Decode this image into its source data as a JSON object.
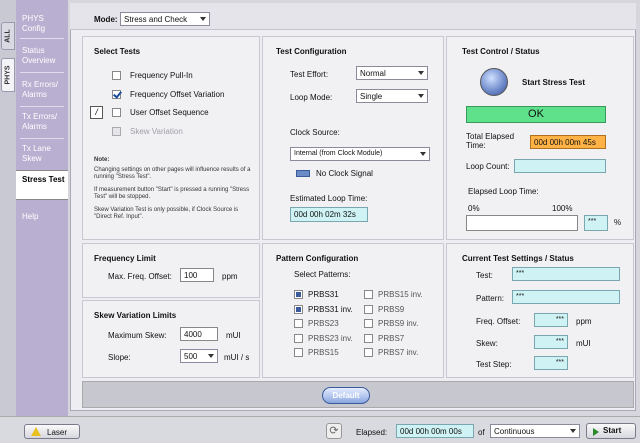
{
  "side_tabs": [
    "ALL",
    "PHYS"
  ],
  "nav": {
    "items": [
      "PHYS Config",
      "Status Overview",
      "Rx Errors/ Alarms",
      "Tx Errors/ Alarms",
      "Tx Lane Skew",
      "Stress Test",
      "Help"
    ]
  },
  "mode": {
    "label": "Mode:",
    "value": "Stress and Check"
  },
  "select_tests": {
    "title": "Select Tests",
    "items": [
      {
        "label": "Frequency Pull-In",
        "checked": false
      },
      {
        "label": "Frequency Offset Variation",
        "checked": true
      },
      {
        "label": "User Offset Sequence",
        "checked": false
      },
      {
        "label": "Skew Variation",
        "checked": false
      }
    ],
    "note_title": "Note:",
    "note1": "Changing settings on other pages will influence results of a running \"Stress Test\".",
    "note2": "If measurement button \"Start\" is pressed a running \"Stress Test\" will be stopped.",
    "note3": "Skew Variation Test is only possible, if Clock Source is \"Direct Ref. Input\"."
  },
  "test_config": {
    "title": "Test Configuration",
    "effort_label": "Test Effort:",
    "effort_value": "Normal",
    "loop_label": "Loop Mode:",
    "loop_value": "Single",
    "clock_label": "Clock Source:",
    "clock_value": "Internal (from Clock Module)",
    "no_clock": "No Clock Signal",
    "est_label": "Estimated Loop Time:",
    "est_value": "00d 00h 02m 32s"
  },
  "test_control": {
    "title": "Test Control / Status",
    "start_label": "Start Stress Test",
    "ok": "OK",
    "total_label": "Total Elapsed Time:",
    "total_value": "00d 00h 00m 45s",
    "loop_count_label": "Loop Count:",
    "loop_count_value": "",
    "elapsed_loop_label": "Elapsed Loop Time:",
    "pct0": "0%",
    "pct100": "100%",
    "pct_value": "***",
    "pct_unit": "%",
    "progress_fraction": 0.0
  },
  "freq_limit": {
    "title": "Frequency Limit",
    "label": "Max. Freq. Offset:",
    "value": "100",
    "unit": "ppm"
  },
  "skew_limits": {
    "title": "Skew Variation Limits",
    "max_label": "Maximum Skew:",
    "max_value": "4000",
    "max_unit": "mUI",
    "slope_label": "Slope:",
    "slope_value": "500",
    "slope_unit": "mUI / s"
  },
  "pattern_config": {
    "title": "Pattern Configuration",
    "select_label": "Select Patterns:",
    "left": [
      {
        "label": "PRBS31",
        "checked": true
      },
      {
        "label": "PRBS31 inv.",
        "checked": true
      },
      {
        "label": "PRBS23",
        "checked": false
      },
      {
        "label": "PRBS23 inv.",
        "checked": false
      },
      {
        "label": "PRBS15",
        "checked": false
      }
    ],
    "right": [
      {
        "label": "PRBS15 inv.",
        "checked": false
      },
      {
        "label": "PRBS9",
        "checked": false
      },
      {
        "label": "PRBS9 inv.",
        "checked": false
      },
      {
        "label": "PRBS7",
        "checked": false
      },
      {
        "label": "PRBS7 inv.",
        "checked": false
      }
    ]
  },
  "current": {
    "title": "Current Test Settings / Status",
    "test_label": "Test:",
    "test_value": "***",
    "pattern_label": "Pattern:",
    "pattern_value": "***",
    "freq_label": "Freq. Offset:",
    "freq_value": "***",
    "freq_unit": "ppm",
    "skew_label": "Skew:",
    "skew_value": "***",
    "skew_unit": "mUI",
    "step_label": "Test Step:",
    "step_value": "***"
  },
  "default_button": "Default",
  "bottom": {
    "laser": "Laser",
    "elapsed_label": "Elapsed:",
    "elapsed_value": "00d 00h 00m 00s",
    "of": "of",
    "mode_value": "Continuous",
    "start": "Start"
  },
  "colors": {
    "ok_green": "#5fe08a",
    "elapsed_orange": "#ffb347",
    "nav_purple": "#b9afd0",
    "cyan_box": "#cff2f4"
  }
}
